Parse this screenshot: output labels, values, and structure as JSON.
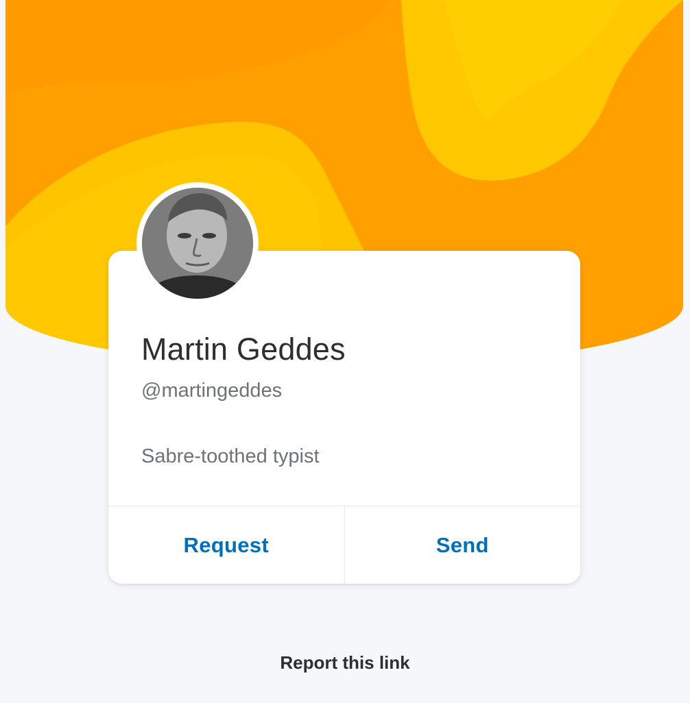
{
  "colors": {
    "hero_orange": "#ff9d00",
    "hero_yellow": "#ffc700",
    "link_blue": "#0070ba",
    "text_dark": "#2c2e2f",
    "text_muted": "#6c7378",
    "background": "#f5f7fa"
  },
  "profile": {
    "name": "Martin Geddes",
    "handle": "@martingeddes",
    "bio": "Sabre-toothed typist",
    "avatar_icon": "profile-photo"
  },
  "actions": {
    "request_label": "Request",
    "send_label": "Send"
  },
  "footer": {
    "report_label": "Report this link"
  }
}
